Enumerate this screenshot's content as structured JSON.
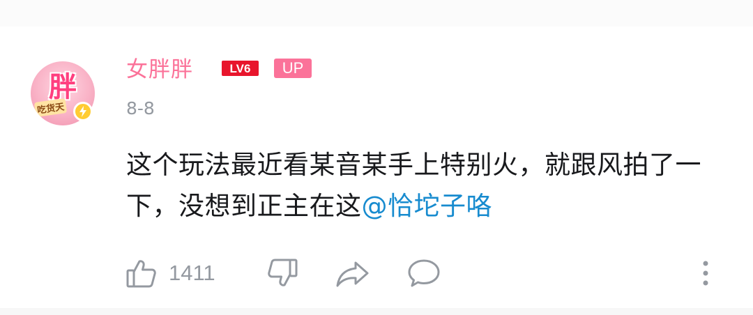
{
  "user": {
    "name": "女胖胖",
    "level": "LV6",
    "up_badge": "UP",
    "avatar_text": "胖",
    "avatar_subtext": "吃货天"
  },
  "comment": {
    "date": "8-8",
    "text": "这个玩法最近看某音某手上特别火，就跟风拍了一下，没想到正主在这",
    "mention": "@恰坨子咯"
  },
  "actions": {
    "like_count": "1411"
  },
  "colors": {
    "username": "#fb7299",
    "mention": "#178bcf",
    "muted": "#9499a0",
    "text": "#18191c",
    "level_badge": "#e8152c"
  }
}
